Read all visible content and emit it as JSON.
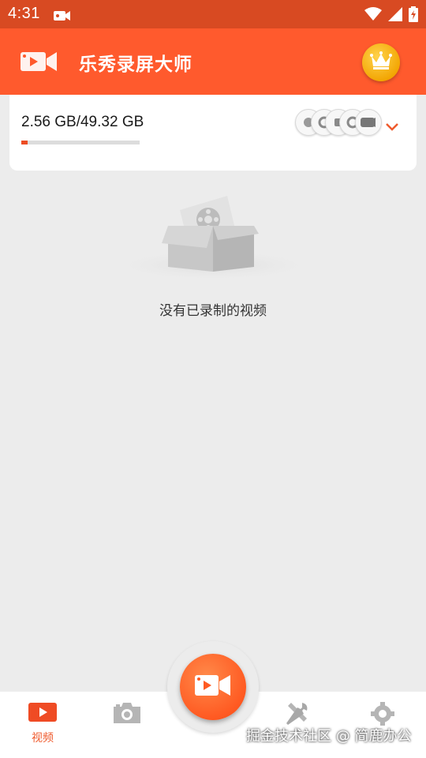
{
  "status_bar": {
    "time": "4:31",
    "icons": [
      "video-record-icon",
      "wifi-icon",
      "cell-signal-icon",
      "battery-icon"
    ]
  },
  "app_bar": {
    "title": "乐秀录屏大师",
    "vip_icon": "crown-icon"
  },
  "storage": {
    "text": "2.56 GB/49.32 GB",
    "used_fraction": 0.052,
    "app_icons_count": 5,
    "expand_icon": "chevron-down-icon"
  },
  "empty_state": {
    "message": "没有已录制的视频",
    "illustration": "empty-box-film-icon"
  },
  "bottom_nav": {
    "items": [
      {
        "label": "视频",
        "icon": "video-icon",
        "active": true
      },
      {
        "label": "",
        "icon": "camera-icon",
        "active": false
      },
      {
        "label": "",
        "icon": "record-icon",
        "active": false
      },
      {
        "label": "",
        "icon": "tools-icon",
        "active": false
      },
      {
        "label": "",
        "icon": "gear-icon",
        "active": false
      }
    ]
  },
  "watermark": "掘金技术社区 @ 简鹿办公",
  "colors": {
    "status_bar": "#d84a22",
    "app_bar": "#ff5a2d",
    "accent": "#ef5a2c",
    "background": "#ececec",
    "crown": "#f2a400"
  }
}
